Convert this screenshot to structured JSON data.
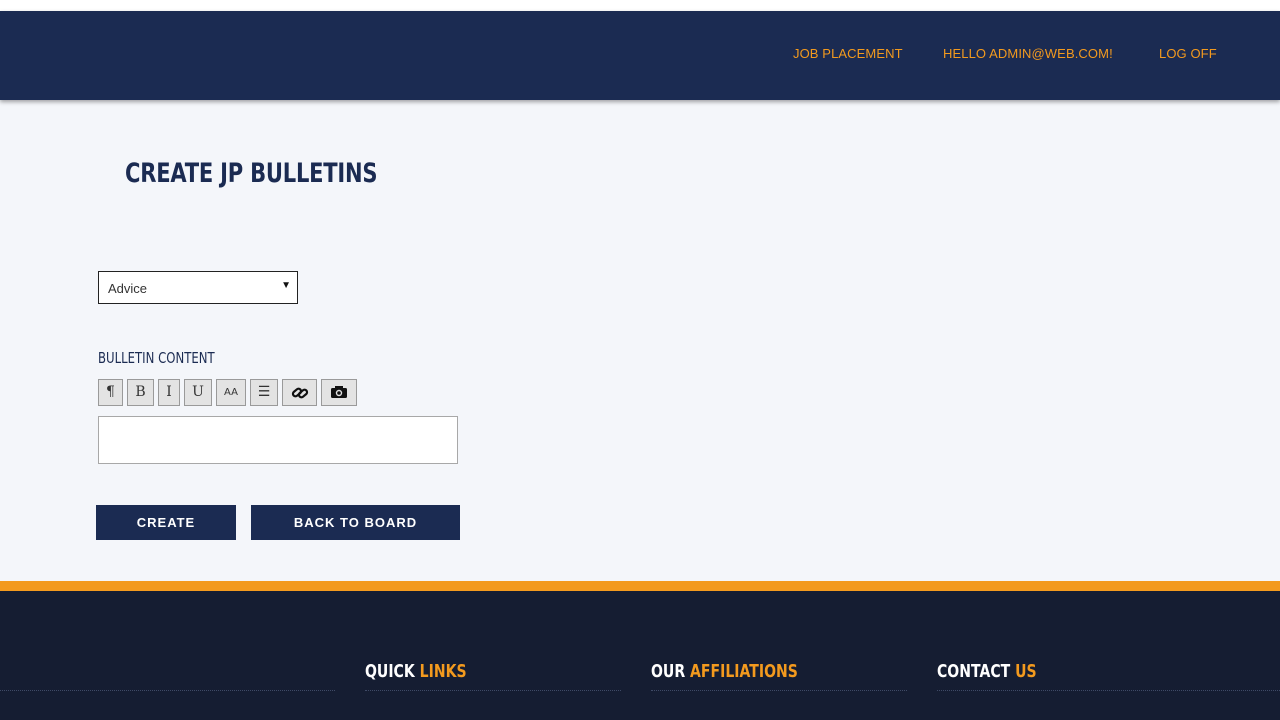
{
  "header": {
    "nav": [
      "JOB PLACEMENT",
      "HELLO ADMIN@WEB.COM!",
      "LOG OFF"
    ]
  },
  "main": {
    "title": "CREATE JP BULLETINS",
    "category_select": {
      "value": "Advice"
    },
    "content_label": "BULLETIN CONTENT",
    "toolbar": [
      {
        "label": "¶",
        "icon": "paragraph-icon"
      },
      {
        "label": "B",
        "icon": "bold-icon"
      },
      {
        "label": "I",
        "icon": "italic-icon"
      },
      {
        "label": "U",
        "icon": "underline-icon"
      },
      {
        "label": "AA",
        "icon": "font-size-icon"
      },
      {
        "label": "☰",
        "icon": "list-icon"
      },
      {
        "label": "",
        "icon": "link-icon"
      },
      {
        "label": "",
        "icon": "camera-icon"
      }
    ],
    "buttons": {
      "create": "CREATE",
      "back": "BACK TO BOARD"
    }
  },
  "footer": {
    "headings": [
      {
        "white": "QUICK",
        "orange": "LINKS"
      },
      {
        "white": "OUR",
        "orange": "AFFILIATIONS"
      },
      {
        "white": "CONTACT",
        "orange": "US"
      }
    ]
  },
  "colors": {
    "navy": "#1b2b52",
    "accent": "#f39a1e",
    "footer": "#151d32",
    "page_bg": "#f4f6fa"
  }
}
